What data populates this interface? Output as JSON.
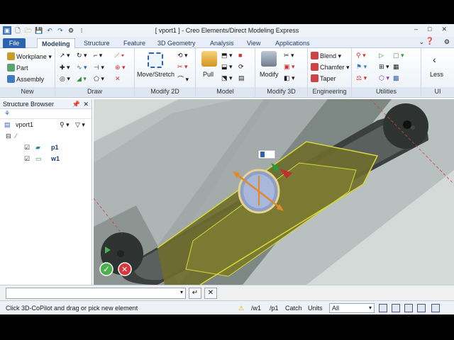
{
  "window": {
    "title": "[ vport1 ] - Creo Elements/Direct Modeling Express",
    "controls": [
      "–",
      "□",
      "✕"
    ]
  },
  "tabs": [
    {
      "label": "File"
    },
    {
      "label": "Modeling"
    },
    {
      "label": "Structure"
    },
    {
      "label": "Feature"
    },
    {
      "label": "3D Geometry"
    },
    {
      "label": "Analysis"
    },
    {
      "label": "View"
    },
    {
      "label": "Applications"
    }
  ],
  "ribbon": {
    "new": {
      "label": "New",
      "workplane": "Workplane",
      "part": "Part",
      "assembly": "Assembly"
    },
    "draw": {
      "label": "Draw"
    },
    "modify2d": {
      "label": "Modify 2D",
      "move_stretch": "Move/Stretch"
    },
    "model": {
      "label": "Model",
      "pull": "Pull"
    },
    "modify3d": {
      "label": "Modify 3D",
      "modify": "Modify"
    },
    "engineering": {
      "label": "Engineering",
      "blend": "Blend",
      "chamfer": "Chamfer",
      "taper": "Taper"
    },
    "utilities": {
      "label": "Utilities"
    },
    "ui": {
      "label": "UI",
      "less": "Less"
    }
  },
  "structure_browser": {
    "title": "Structure Browser",
    "root": "vport1",
    "items": [
      {
        "label": "p1"
      },
      {
        "label": "w1"
      }
    ]
  },
  "command": {
    "value": "",
    "confirm_icon": "enter-icon",
    "cancel_icon": "close-icon"
  },
  "status": {
    "message": "Click 3D-CoPilot and drag or pick new element",
    "workplane": "/w1",
    "part": "/p1",
    "catch": "Catch",
    "units": "Units",
    "filter": "All"
  },
  "colors": {
    "accent": "#2d62ad",
    "model_face": "#6b6a2a",
    "highlight": "#d8d83a"
  }
}
